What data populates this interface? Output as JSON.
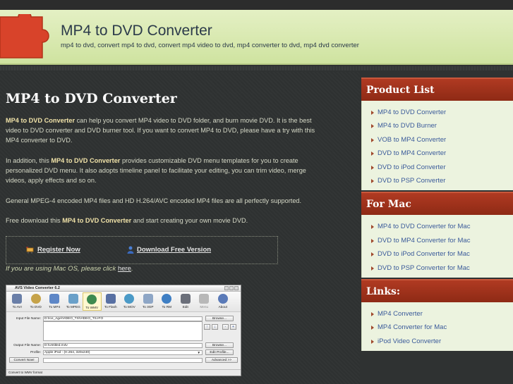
{
  "header": {
    "title": "MP4 to DVD Converter",
    "subtitle": "mp4 to dvd, convert mp4 to dvd, convert mp4 video to dvd, mp4 converter to dvd, mp4 dvd converter"
  },
  "main": {
    "title": "MP4 to DVD Converter",
    "p1_bold": "MP4 to DVD Converter",
    "p1_rest": " can help you convert MP4 video to DVD folder, and burn movie DVD. It is the best video to DVD converter and DVD burner tool. If you want to convert MP4 to DVD, please have a try with this MP4 converter to DVD.",
    "p2_pre": "In addition, this ",
    "p2_bold": "MP4 to DVD Converter",
    "p2_rest": " provides customizable DVD menu templates for you to create personalized DVD menu. It also adopts timeline panel to facilitate your editing, you can trim video, merge videos, apply effects and so on.",
    "p3": "General MPEG-4 encoded MP4 files and HD H.264/AVC encoded MP4 files are all perfectly supported.",
    "p4_pre": "Free download this ",
    "p4_bold": "MP4 to DVD Converter",
    "p4_rest": " and start creating your own movie DVD.",
    "register_label": "Register Now",
    "download_label": "Download Free Version",
    "mac_note_pre": "If you are using Mac OS, please click ",
    "mac_note_link": "here",
    "mac_note_post": "."
  },
  "app": {
    "title": "AVS Video Converter 6.2",
    "tools": [
      "To AVI",
      "To DVD",
      "To MP4",
      "To MPEG",
      "To WMV",
      "To Flash",
      "To MOV",
      "To 3GP",
      "To RM",
      "Edit",
      "Menu",
      "About"
    ],
    "input_label": "Input File Name:",
    "input_value": "D:\\Ice_Age\\VIDEO_TS\\VIDEO_TS.IFO",
    "browse1": "Browse...",
    "output_label": "Output File Name:",
    "output_value": "D:\\Untitled.m4v",
    "browse2": "Browse...",
    "profile_label": "Profile:",
    "profile_value": "Apple iPod - (H.264, 320x240)",
    "edit_profile": "Edit Profile...",
    "convert_btn": "Convert Now!",
    "advanced_btn": "Advanced >>",
    "status": "Convert to WMV format",
    "up_arrow": "↑",
    "down_arrow": "↓",
    "minus": "-",
    "plus": "+"
  },
  "sidebar": {
    "product_head": "Product List",
    "products": [
      "MP4 to DVD Converter",
      "MP4 to DVD Burner",
      "VOB to MP4 Converter",
      "DVD to MP4 Converter",
      "DVD to iPod Converter",
      "DVD to PSP Converter"
    ],
    "mac_head": "For Mac",
    "mac_items": [
      "MP4 to DVD Converter for Mac",
      "DVD to MP4 Converter for Mac",
      "DVD to iPod Converter for Mac",
      "DVD to PSP Converter for Mac"
    ],
    "links_head": "Links:",
    "links": [
      "MP4 Converter",
      "MP4 Converter for Mac",
      "iPod Video Converter"
    ]
  },
  "colors": {
    "accent_red": "#a0301a",
    "header_green": "#d8e9b0",
    "link_blue": "#3a5a9a"
  }
}
